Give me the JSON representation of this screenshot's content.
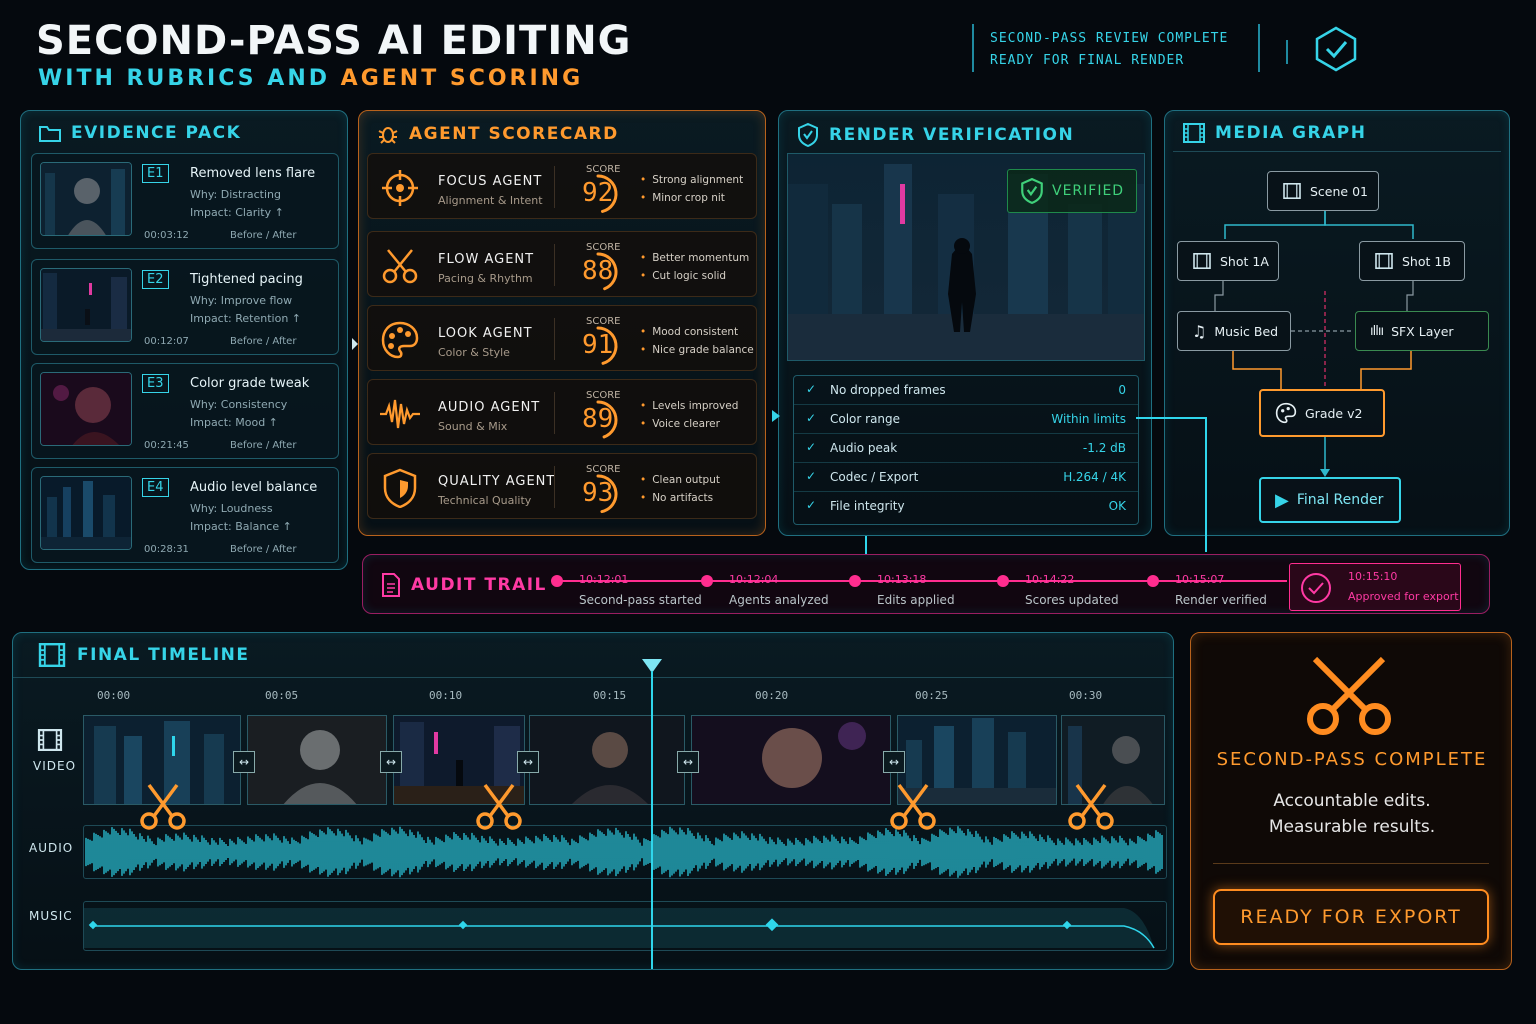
{
  "header": {
    "title": "SECOND-PASS AI EDITING",
    "subtitle_part1": "WITH RUBRICS AND",
    "subtitle_part2": "AGENT SCORING",
    "status_line1": "SECOND-PASS REVIEW COMPLETE",
    "status_line2": "READY FOR FINAL RENDER"
  },
  "evidence": {
    "title": "EVIDENCE PACK",
    "items": [
      {
        "id": "E1",
        "title": "Removed lens flare",
        "why": "Why:   Distracting",
        "impact": "Impact:  Clarity ↑",
        "time": "00:03:12",
        "ba": "Before  /  After"
      },
      {
        "id": "E2",
        "title": "Tightened pacing",
        "why": "Why:   Improve flow",
        "impact": "Impact:  Retention ↑",
        "time": "00:12:07",
        "ba": "Before  /  After"
      },
      {
        "id": "E3",
        "title": "Color grade tweak",
        "why": "Why:   Consistency",
        "impact": "Impact:  Mood ↑",
        "time": "00:21:45",
        "ba": "Before  /  After"
      },
      {
        "id": "E4",
        "title": "Audio level balance",
        "why": "Why:   Loudness",
        "impact": "Impact:  Balance ↑",
        "time": "00:28:31",
        "ba": "Before  /  After"
      }
    ]
  },
  "scorecard": {
    "title": "AGENT SCORECARD",
    "score_label": "SCORE",
    "agents": [
      {
        "name": "FOCUS AGENT",
        "sub": "Alignment & Intent",
        "score": "92",
        "score_num": 92,
        "notes": [
          "Strong alignment",
          "Minor crop nit"
        ],
        "icon": "crosshair-icon"
      },
      {
        "name": "FLOW AGENT",
        "sub": "Pacing & Rhythm",
        "score": "88",
        "score_num": 88,
        "notes": [
          "Better momentum",
          "Cut logic solid"
        ],
        "icon": "scissors-icon"
      },
      {
        "name": "LOOK AGENT",
        "sub": "Color & Style",
        "score": "91",
        "score_num": 91,
        "notes": [
          "Mood consistent",
          "Nice grade balance"
        ],
        "icon": "palette-icon"
      },
      {
        "name": "AUDIO AGENT",
        "sub": "Sound & Mix",
        "score": "89",
        "score_num": 89,
        "notes": [
          "Levels improved",
          "Voice clearer"
        ],
        "icon": "waveform-icon"
      },
      {
        "name": "QUALITY AGENT",
        "sub": "Technical Quality",
        "score": "93",
        "score_num": 93,
        "notes": [
          "Clean output",
          "No artifacts"
        ],
        "icon": "shield-icon"
      }
    ]
  },
  "render": {
    "title": "RENDER VERIFICATION",
    "badge": "VERIFIED",
    "checks": [
      {
        "label": "No dropped frames",
        "value": "0"
      },
      {
        "label": "Color range",
        "value": "Within limits"
      },
      {
        "label": "Audio peak",
        "value": "-1.2 dB"
      },
      {
        "label": "Codec / Export",
        "value": "H.264 / 4K"
      },
      {
        "label": "File integrity",
        "value": "OK"
      }
    ]
  },
  "media_graph": {
    "title": "MEDIA GRAPH",
    "nodes": {
      "scene": "Scene 01",
      "shot_a": "Shot 1A",
      "shot_b": "Shot 1B",
      "music": "Music Bed",
      "sfx": "SFX Layer",
      "grade": "Grade v2",
      "final": "Final Render"
    }
  },
  "audit": {
    "title": "AUDIT TRAIL",
    "events": [
      {
        "time": "10:12:01",
        "label": "Second-pass started"
      },
      {
        "time": "10:12:04",
        "label": "Agents analyzed"
      },
      {
        "time": "10:13:18",
        "label": "Edits applied"
      },
      {
        "time": "10:14:22",
        "label": "Scores updated"
      },
      {
        "time": "10:15:07",
        "label": "Render verified"
      }
    ],
    "final": {
      "time": "10:15:10",
      "label": "Approved for export"
    }
  },
  "timeline": {
    "title": "FINAL TIMELINE",
    "ticks": [
      "00:00",
      "00:05",
      "00:10",
      "00:15",
      "00:20",
      "00:25",
      "00:30"
    ],
    "tracks": {
      "video": "VIDEO",
      "audio": "AUDIO",
      "music": "MUSIC"
    }
  },
  "export": {
    "title": "SECOND-PASS COMPLETE",
    "line1": "Accountable edits.",
    "line2": "Measurable results.",
    "button": "READY FOR EXPORT"
  },
  "colors": {
    "accent_cyan": "#36d4e8",
    "accent_orange": "#ff9a2e",
    "accent_pink": "#ff2d8f",
    "verified_green": "#3fd07a"
  }
}
